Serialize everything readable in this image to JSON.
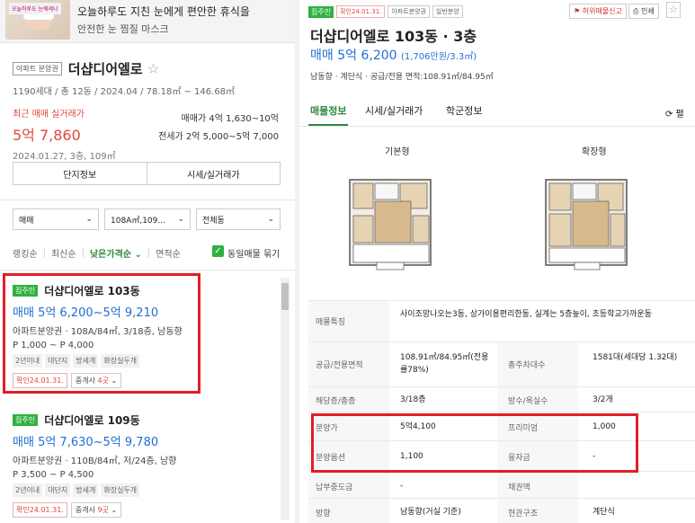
{
  "ad": {
    "thumb_tag": "오늘하루도 눈에세니",
    "title": "오늘하루도 지친 눈에게 편안한 휴식을",
    "subtitle": "안전한 눈 찜질 마스크"
  },
  "complex": {
    "badge": "아파트 분양권",
    "name": "더샵디어엘로",
    "star": "☆",
    "info": "1190세대 / 총 12동 / 2024.04 / 78.18㎡ ~ 146.68㎡",
    "recent_label": "최근 매매 실거래가",
    "recent_price": "5억 7,860",
    "recent_date": "2024.01.27, 3층, 109㎡",
    "sale_range": "매매가 4억 1,630~10억",
    "lease_range": "전세가 2억 5,000~5억 7,000",
    "btn_info": "단지정보",
    "btn_trade": "시세/실거래가"
  },
  "filters": {
    "type": "매매",
    "size": "108A㎡,109...",
    "building": "전체동"
  },
  "sorts": {
    "s1": "랭킹순",
    "s2": "최신순",
    "s3": "낮은가격순",
    "s3_arrow": "⌄",
    "s4": "면적순",
    "same_listing": "동일매물 묶기"
  },
  "listings": [
    {
      "chip": "집주인",
      "name": "더샵디어엘로 103동",
      "price_label": "매매",
      "price": "5억 6,200~5억 9,210",
      "spec": "아파트분양권 · 108A/84㎡, 3/18층, 남동향",
      "range": "P 1,000 ~ P 4,000",
      "tags": [
        "2년이내",
        "대단지",
        "방세개",
        "화장실두개"
      ],
      "confirm": "확인24.01.31.",
      "agent_prefix": "중개사",
      "agent_count": "4곳"
    },
    {
      "chip": "집주인",
      "name": "더샵디어엘로 109동",
      "price_label": "매매",
      "price": "5억 7,630~5억 9,780",
      "spec": "아파트분양권 · 110B/84㎡, 저/24층, 남향",
      "range": "P 3,500 ~ P 4,500",
      "tags": [
        "2년이내",
        "대단지",
        "방세개",
        "화장실두개"
      ],
      "confirm": "확인24.01.31.",
      "agent_prefix": "중개사",
      "agent_count": "9곳"
    }
  ],
  "detail": {
    "chip_owner": "집주인",
    "chip_confirm": "확인24.01.31.",
    "chip_type": "아파트분양권",
    "chip_kind": "일반분양",
    "report": "허위매물신고",
    "print": "인쇄",
    "star": "☆",
    "title": "더샵디어엘로 103동 · 3층",
    "price_label": "매매",
    "price": "5억 6,200",
    "price_per": "(1,706만원/3.3㎡)",
    "spec": "남동향  ·  계단식  ·  공급/전용 면적:108.91㎡/84.95㎡",
    "tabs": [
      "매물정보",
      "시세/실거래가",
      "학군정보"
    ],
    "refresh": "⟳ 펼",
    "plan1": "기본형",
    "plan2": "확장형",
    "table": {
      "feature_label": "매물특징",
      "feature_value": "사이조망나오는3동, 상가이용편리한동, 실계는 5층높이, 초등학교가까운동",
      "area_label": "공급/전용면적",
      "area_value": "108.91㎡/84.95㎡(전용률78%)",
      "parking_label": "총주차대수",
      "parking_value": "1581대(세대당 1.32대)",
      "floor_label": "해당층/총층",
      "floor_value": "3/18층",
      "rooms_label": "방수/욕실수",
      "rooms_value": "3/2개",
      "presale_label": "분양가",
      "presale_value": "5억4,100",
      "premium_label": "프리미엄",
      "premium_value": "1,000",
      "option_label": "분양옵션",
      "option_value": "1,100",
      "loan_label": "융자금",
      "loan_value": "-",
      "paid_label": "납부중도금",
      "paid_value": "-",
      "lease_label": "채권액",
      "lease_value": "",
      "dir_label": "방향",
      "dir_value": "남동향(거실 기준)",
      "struct_label": "현관구조",
      "struct_value": "계단식"
    }
  }
}
